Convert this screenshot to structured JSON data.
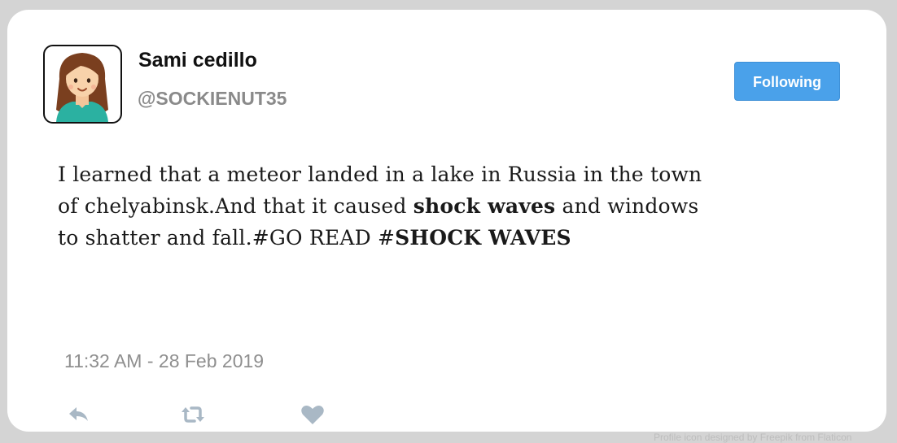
{
  "user": {
    "name": "Sami cedillo",
    "handle": "@SOCKIENUT35",
    "avatar_icon": "girl-avatar-icon"
  },
  "follow_button": {
    "label": "Following",
    "color": "#4aa1ea"
  },
  "tweet": {
    "line1": "I learned that a meteor landed in a lake in Russia in the town",
    "line2_a": "of chelyabinsk.And that it caused ",
    "line2_b": "shock waves",
    "line2_c": " and windows",
    "line3_a": "to shatter and fall.#GO READ #",
    "line3_b": "SHOCK WAVES"
  },
  "timestamp": "11:32 AM - 28 Feb 2019",
  "actions": [
    {
      "icon": "reply-icon"
    },
    {
      "icon": "retweet-icon"
    },
    {
      "icon": "heart-icon"
    }
  ],
  "footer": {
    "credit": "Profile icon designed by Freepik from Flaticon"
  }
}
